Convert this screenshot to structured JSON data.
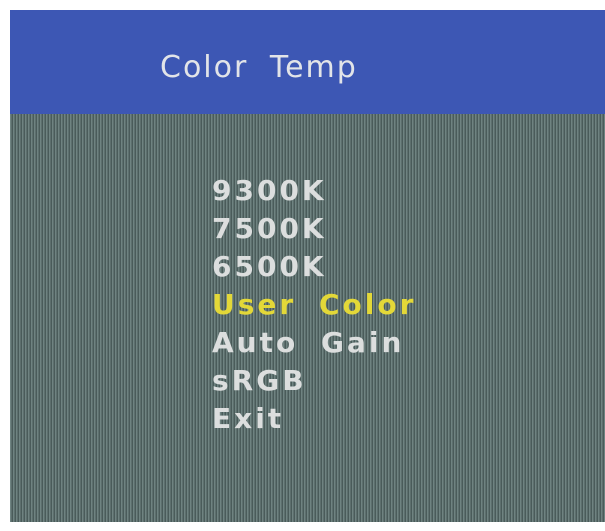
{
  "osd": {
    "title": "Color Temp",
    "colors": {
      "header": "#3d57b4",
      "item": "#dcdede",
      "selected": "#e3d838"
    },
    "menu": [
      {
        "label": "9300K",
        "selected": false
      },
      {
        "label": "7500K",
        "selected": false
      },
      {
        "label": "6500K",
        "selected": false
      },
      {
        "label": "User Color",
        "selected": true
      },
      {
        "label": "Auto Gain",
        "selected": false
      },
      {
        "label": "sRGB",
        "selected": false
      },
      {
        "label": "Exit",
        "selected": false
      }
    ]
  }
}
